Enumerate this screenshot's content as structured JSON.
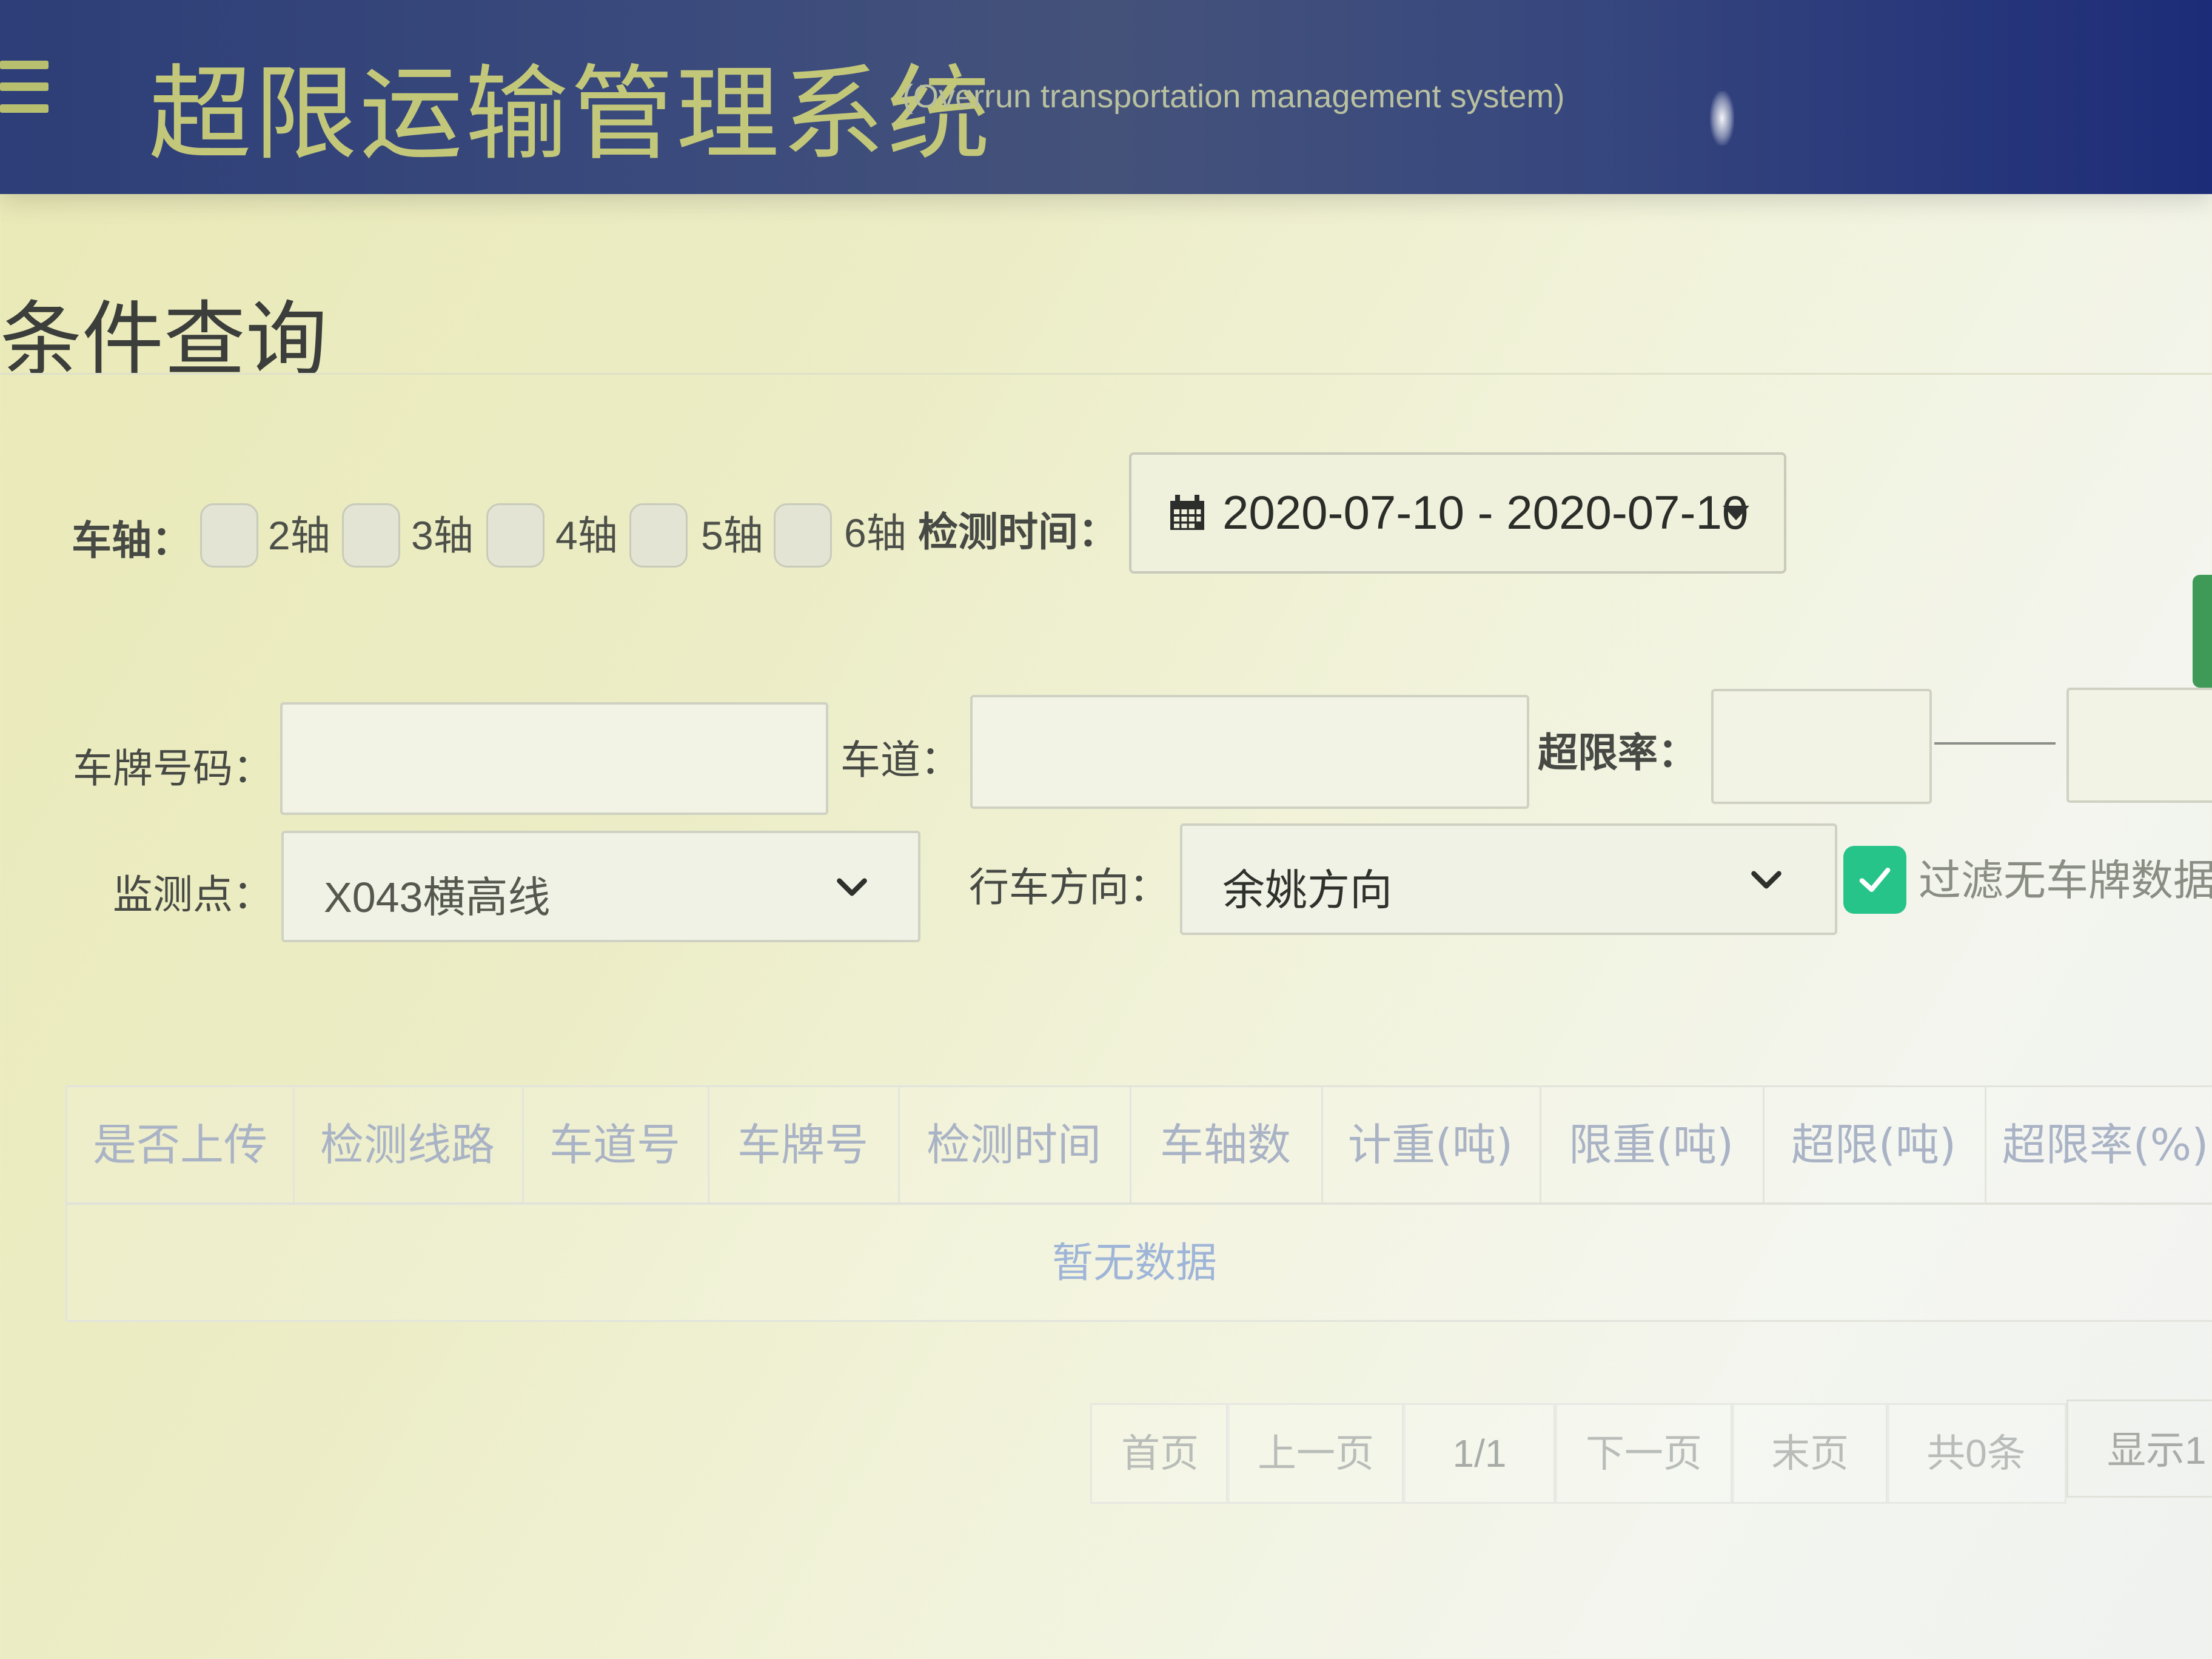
{
  "header": {
    "title": "超限运输管理系统",
    "subtitle": "(Overrun transportation management system)",
    "menu_icon": "hamburger-icon"
  },
  "query": {
    "section_title": "条件查询",
    "axle": {
      "label": "车轴：",
      "options": [
        {
          "label": "2轴",
          "checked": false
        },
        {
          "label": "3轴",
          "checked": false
        },
        {
          "label": "4轴",
          "checked": false
        },
        {
          "label": "5轴",
          "checked": false
        },
        {
          "label": "6轴",
          "checked": false
        }
      ]
    },
    "detect_time": {
      "label": "检测时间：",
      "value": "2020-07-10 - 2020-07-10",
      "icon": "calendar-icon"
    },
    "plate": {
      "label": "车牌号码：",
      "value": ""
    },
    "lane": {
      "label": "车道：",
      "value": ""
    },
    "over_rate": {
      "label": "超限率：",
      "min": "",
      "max": ""
    },
    "station": {
      "label": "监测点：",
      "value": "X043横高线"
    },
    "direction": {
      "label": "行车方向：",
      "value": "余姚方向"
    },
    "filter": {
      "label": "过滤无车牌数据",
      "checked": true
    }
  },
  "table": {
    "columns": [
      "是否上传",
      "检测线路",
      "车道号",
      "车牌号",
      "检测时间",
      "车轴数",
      "计重(吨)",
      "限重(吨)",
      "超限(吨)",
      "超限率(%)"
    ],
    "empty_text": "暂无数据"
  },
  "pagination": {
    "first": "首页",
    "prev": "上一页",
    "page": "1/1",
    "next": "下一页",
    "last": "末页",
    "total": "共0条",
    "show": "显示1"
  },
  "colors": {
    "header_bg": "#2d3e78",
    "title": "#c3c779",
    "checkbox_checked": "#27c48a",
    "tab_green": "#3f9a57",
    "empty_text": "#9fb5d8"
  }
}
